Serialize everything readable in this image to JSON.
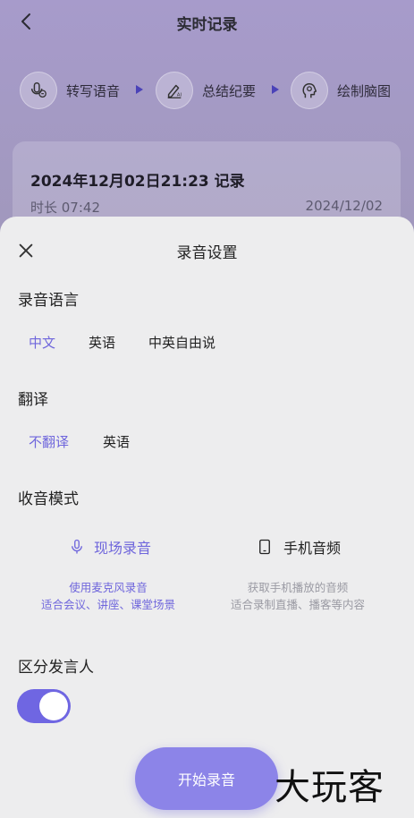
{
  "header": {
    "title": "实时记录"
  },
  "workflow": {
    "steps": [
      {
        "label": "转写语音",
        "icon": "mic-transcribe-icon"
      },
      {
        "label": "总结纪要",
        "icon": "ai-pen-icon"
      },
      {
        "label": "绘制脑图",
        "icon": "brain-head-icon"
      }
    ]
  },
  "record": {
    "title": "2024年12月02日21:23 记录",
    "duration": "时长 07:42",
    "date": "2024/12/02"
  },
  "sheet": {
    "title": "录音设置",
    "language": {
      "label": "录音语言",
      "options": [
        "中文",
        "英语",
        "中英自由说"
      ],
      "selected": "中文"
    },
    "translate": {
      "label": "翻译",
      "options": [
        "不翻译",
        "英语"
      ],
      "selected": "不翻译"
    },
    "mode": {
      "label": "收音模式",
      "options": [
        {
          "label": "现场录音",
          "desc1": "使用麦克风录音",
          "desc2": "适合会议、讲座、课堂场景"
        },
        {
          "label": "手机音频",
          "desc1": "获取手机播放的音频",
          "desc2": "适合录制直播、播客等内容"
        }
      ],
      "selected": "现场录音"
    },
    "speaker": {
      "label": "区分发言人",
      "enabled": true
    },
    "start_label": "开始录音"
  },
  "watermark": "大玩客",
  "colors": {
    "accent": "#6f66dc",
    "sheet_bg": "#ededee",
    "button": "#8c84e8"
  }
}
